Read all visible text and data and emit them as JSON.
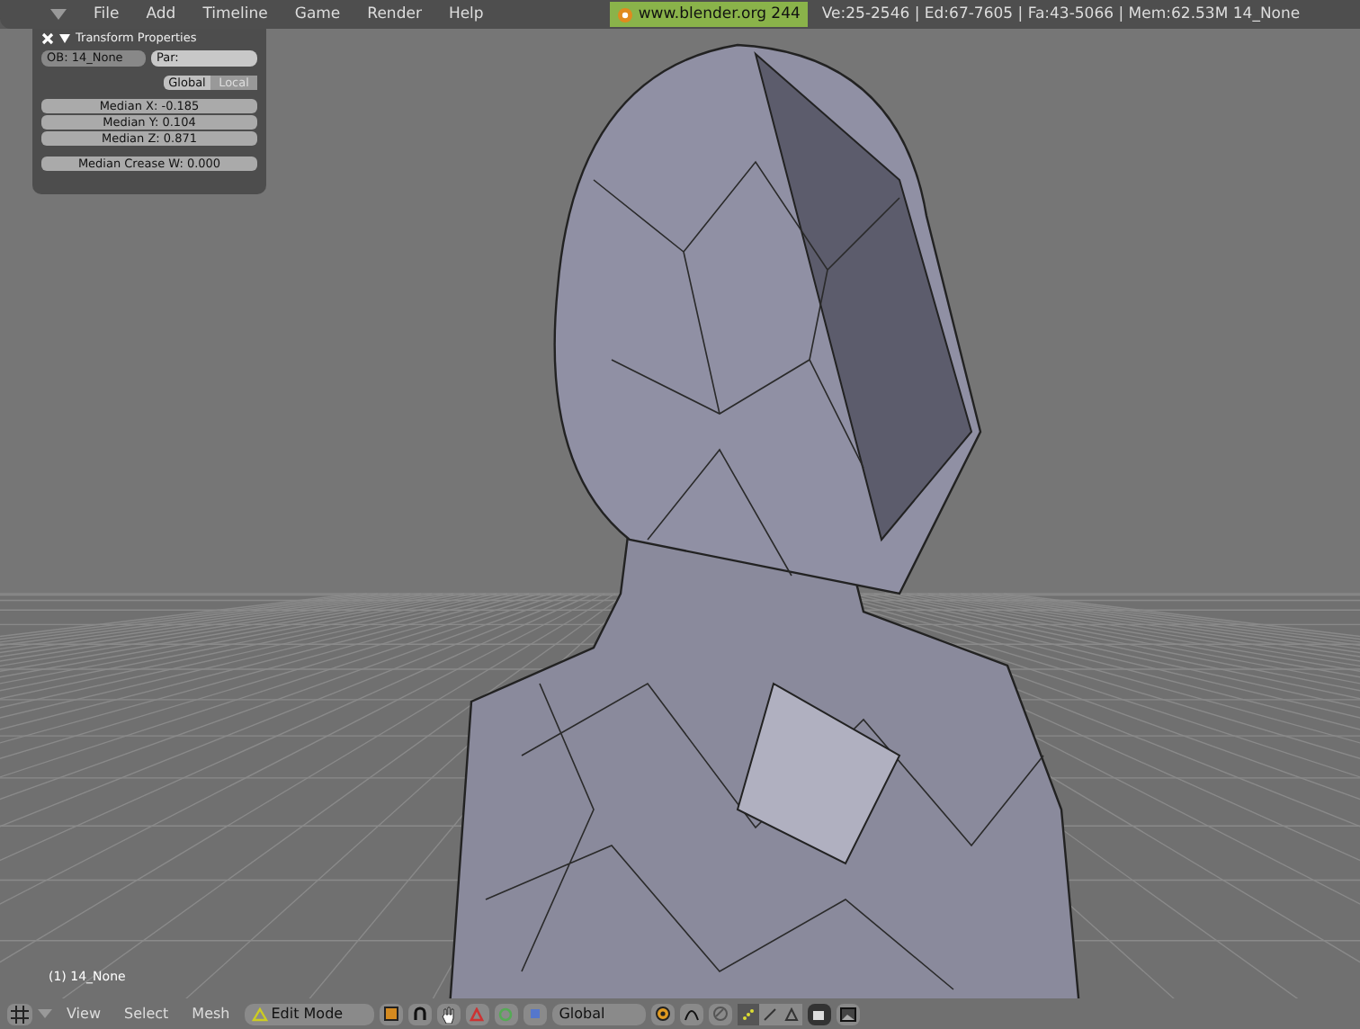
{
  "menu": {
    "items": [
      "File",
      "Add",
      "Timeline",
      "Game",
      "Render",
      "Help"
    ]
  },
  "header_badge": "www.blender.org 244",
  "stats": "Ve:25-2546 | Ed:67-7605 | Fa:43-5066 | Mem:62.53M 14_None",
  "transform_panel": {
    "title": "Transform Properties",
    "object_field": "OB: 14_None",
    "parent_field": "Par:",
    "space_toggle": [
      {
        "label": "Global",
        "selected": true
      },
      {
        "label": "Local",
        "selected": false
      }
    ],
    "fields": [
      "Median X: -0.185",
      "Median Y: 0.104",
      "Median Z: 0.871"
    ],
    "crease_field": "Median Crease W: 0.000"
  },
  "viewport": {
    "object_label": "(1) 14_None"
  },
  "bottom_bar": {
    "menus": [
      "View",
      "Select",
      "Mesh"
    ],
    "mode": "Edit Mode",
    "orientation": "Global",
    "select_modes": [
      {
        "kind": "vertex",
        "selected": true
      },
      {
        "kind": "edge",
        "selected": false
      },
      {
        "kind": "face",
        "selected": false
      }
    ]
  }
}
